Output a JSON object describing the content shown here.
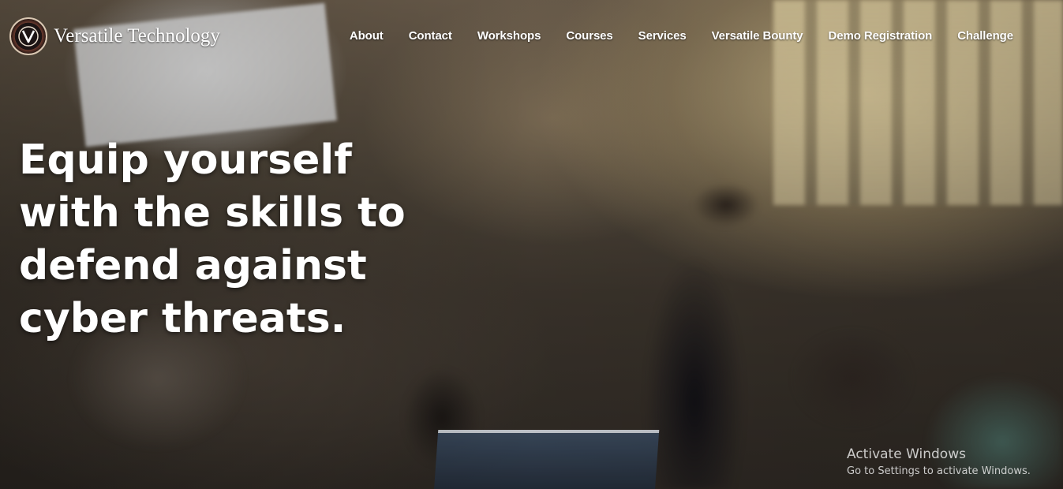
{
  "brand": {
    "name": "Versatile Technology",
    "logo_icon": "versatile-v-emblem"
  },
  "nav": {
    "items": [
      {
        "label": "About"
      },
      {
        "label": "Contact"
      },
      {
        "label": "Workshops"
      },
      {
        "label": "Courses"
      },
      {
        "label": "Services"
      },
      {
        "label": "Versatile Bounty"
      },
      {
        "label": "Demo Registration"
      },
      {
        "label": "Challenge"
      }
    ]
  },
  "hero": {
    "headline": "Equip yourself with the skills to defend against cyber threats."
  },
  "watermark": {
    "title": "Activate Windows",
    "subtitle": "Go to Settings to activate Windows."
  },
  "colors": {
    "text": "#ffffff",
    "logo_ring": "#d9c7b2"
  }
}
